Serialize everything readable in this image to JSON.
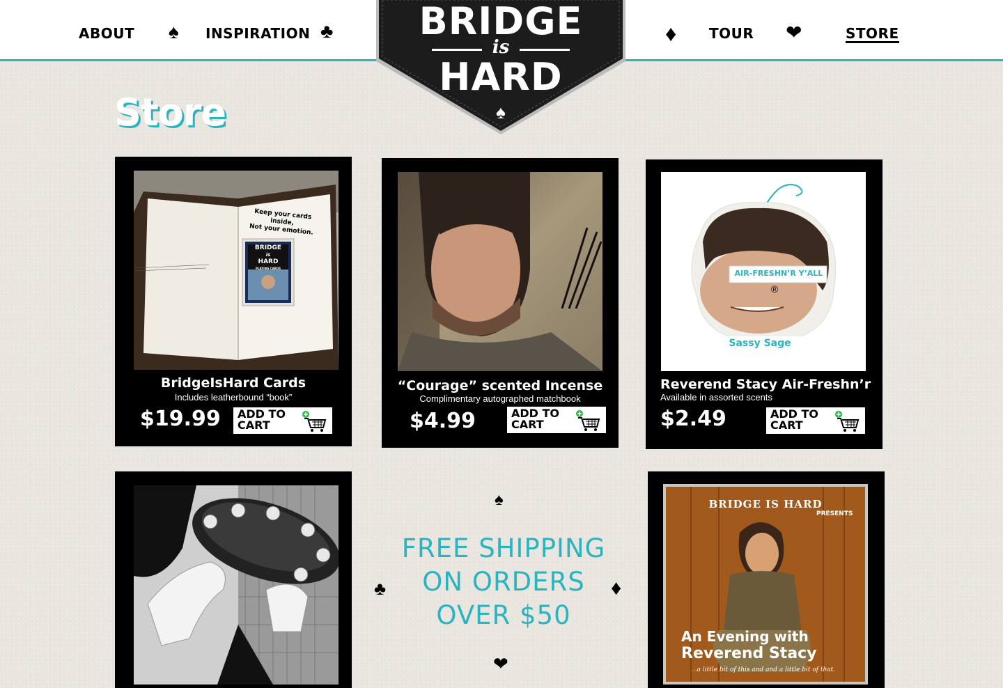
{
  "nav": {
    "about": "ABOUT",
    "inspiration": "INSPIRATION",
    "tour": "TOUR",
    "store": "STORE"
  },
  "logo": {
    "line1": "BRIDGE",
    "line2": "is",
    "line3": "HARD"
  },
  "icons": {
    "spade": "♠",
    "club": "♣",
    "diamond": "♦",
    "heart": "❤"
  },
  "page": {
    "title": "Store"
  },
  "products": [
    {
      "name": "BridgeIsHard Cards",
      "subtitle": "Includes leatherbound “book”",
      "price": "$19.99",
      "button": "ADD TO CART",
      "image": "open-book-with-playing-cards",
      "image_text": [
        "Keep your cards inside,",
        "Not your emotion."
      ],
      "box_text": [
        "BRIDGE",
        "is",
        "HARD",
        "PLAYING CARDS"
      ]
    },
    {
      "name": "“Courage” scented Incense",
      "subtitle": "Complimentary autographed matchbook",
      "price": "$4.99",
      "button": "ADD TO CART",
      "image": "man-with-incense-sticks"
    },
    {
      "name": "Reverend Stacy Air-Freshn’r",
      "subtitle": "Available in assorted scents",
      "price": "$2.49",
      "button": "ADD TO CART",
      "image": "face-air-freshener",
      "image_text": [
        "AIR-FRESHN’R Y’ALL",
        "®",
        "Sassy Sage"
      ]
    },
    {
      "image": "hands-holding-tambourine"
    },
    {
      "image": "cd-cover-an-evening-with-reverend-stacy",
      "image_text": [
        "BRIDGE IS HARD",
        "PRESENTS",
        "An Evening with",
        "Reverend Stacy",
        "...a little bit of this and and a little bit of that."
      ]
    }
  ],
  "promo": {
    "line1": "FREE SHIPPING",
    "line2": "ON ORDERS",
    "line3": "OVER $50"
  },
  "colors": {
    "accent": "#2ab3c0",
    "background": "#e8e6df",
    "card": "#000000"
  }
}
